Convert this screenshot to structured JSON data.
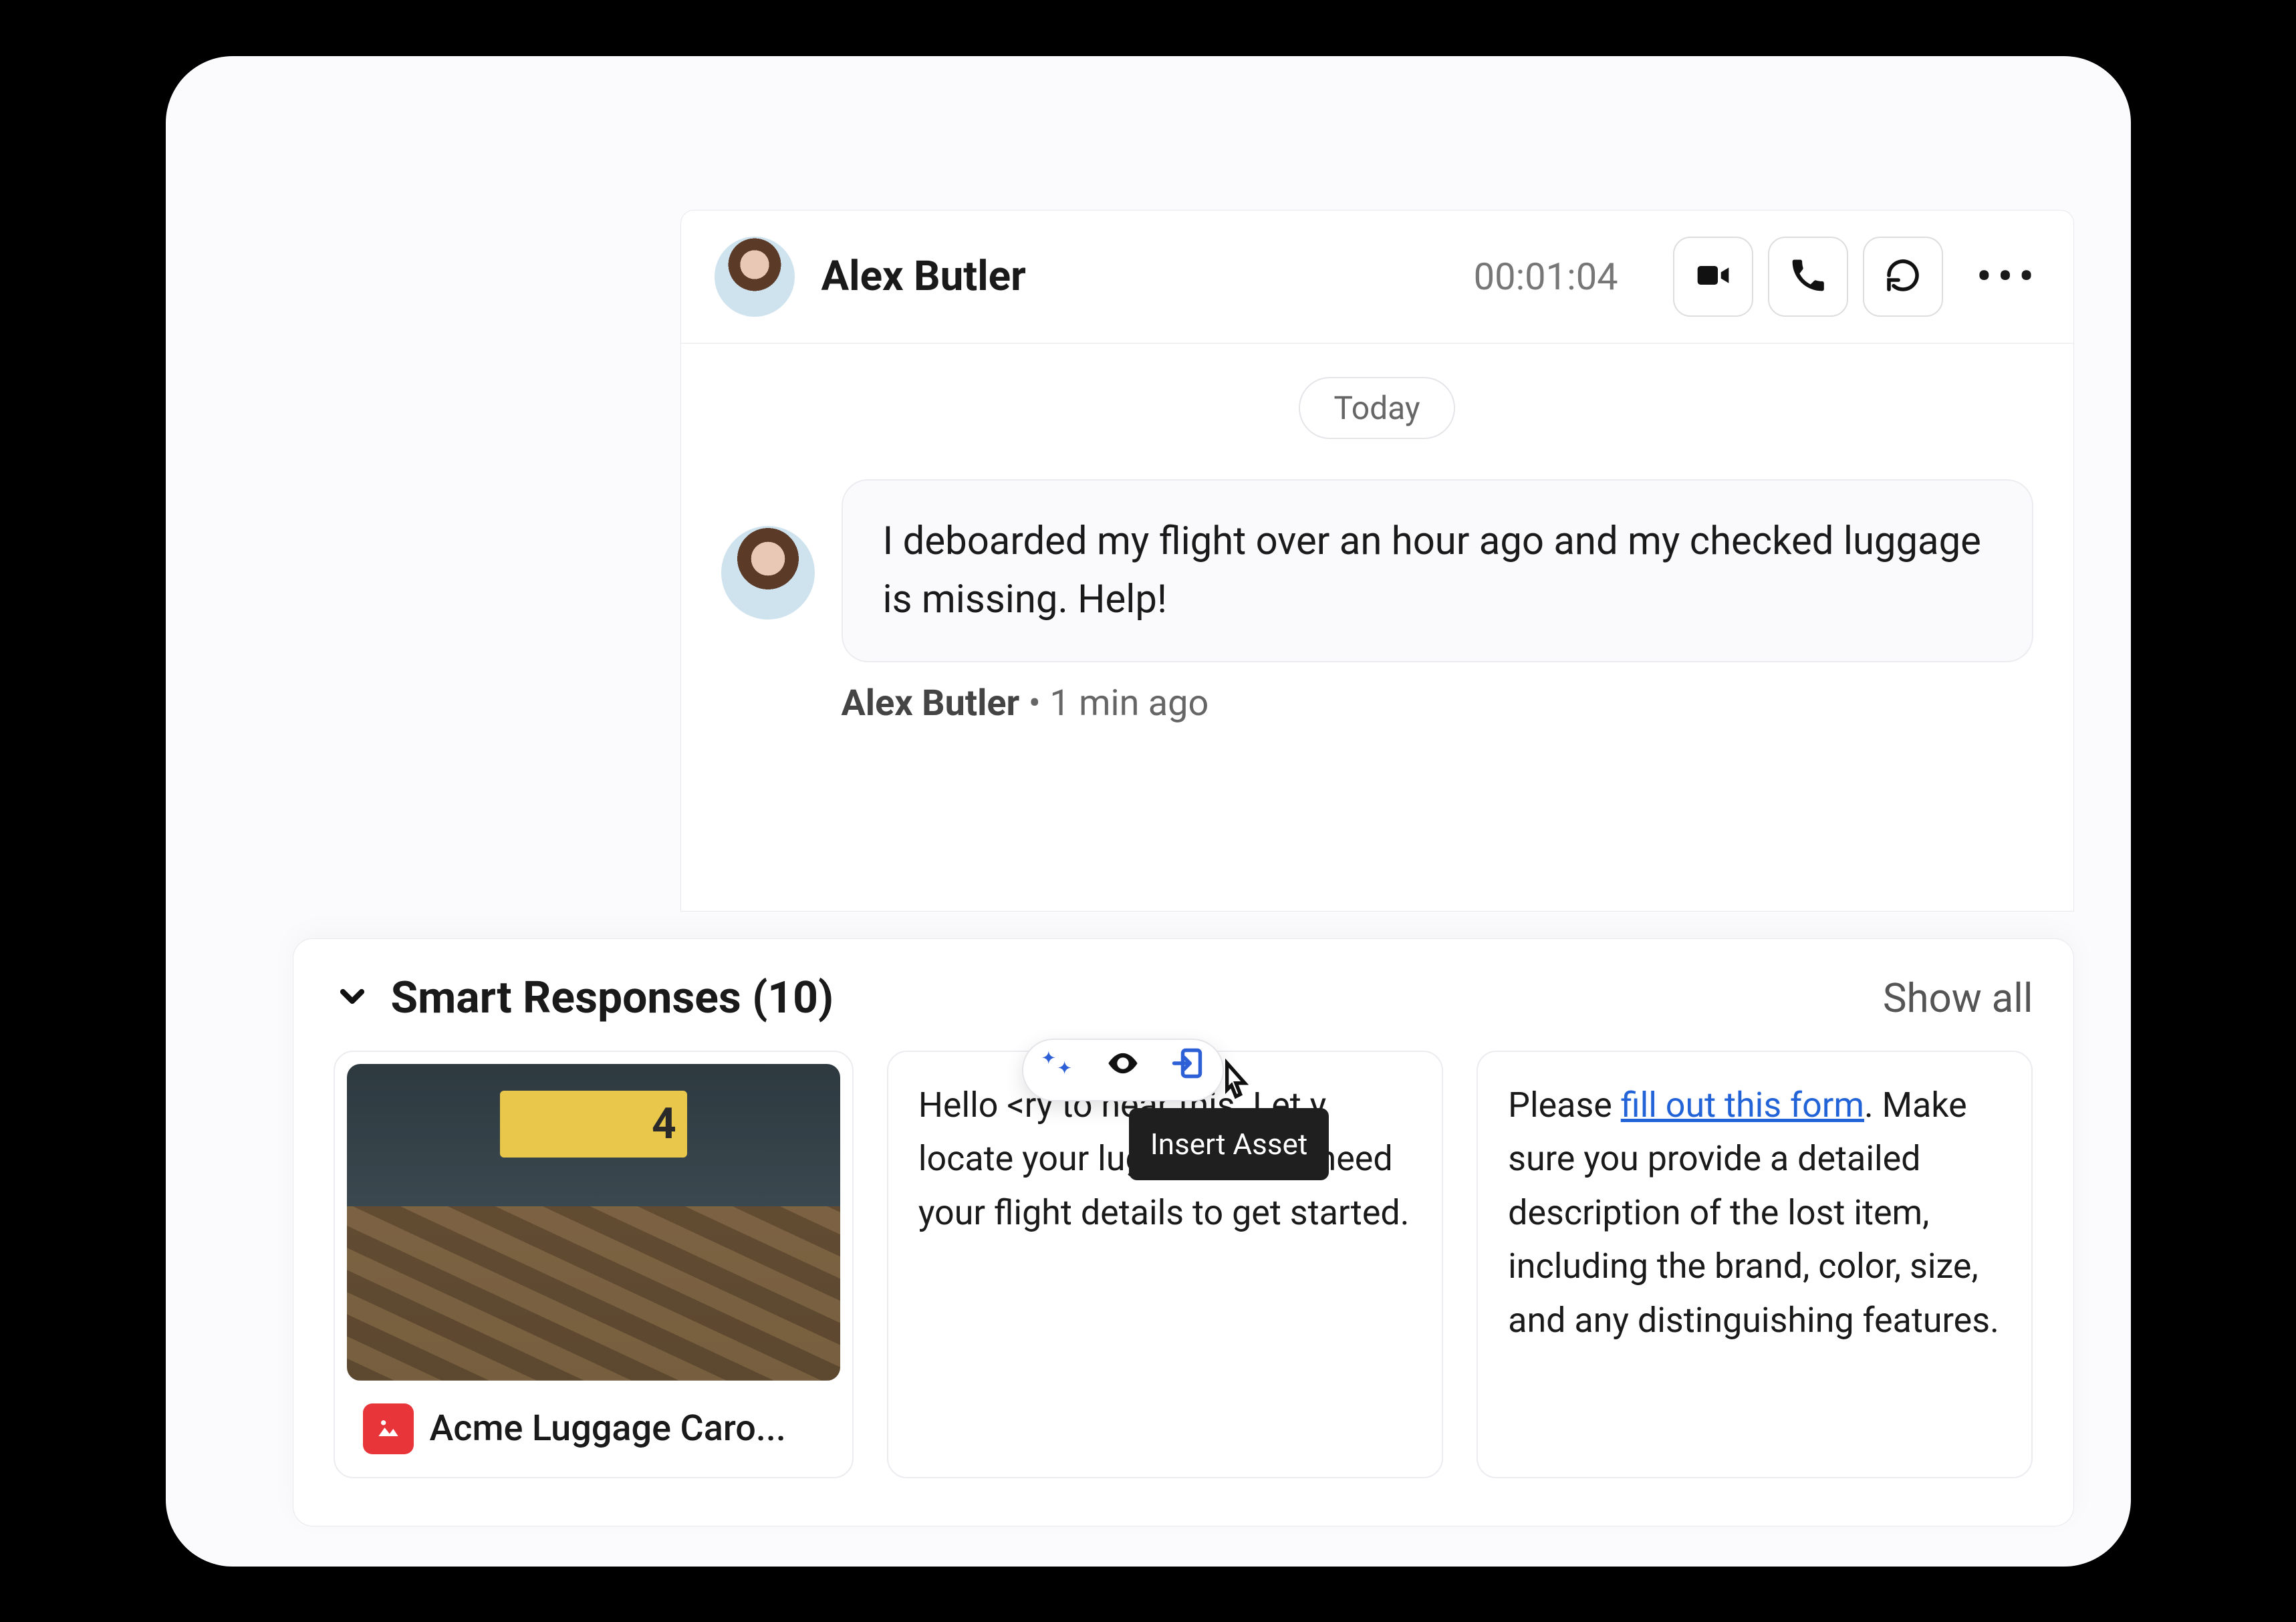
{
  "header": {
    "customer_name": "Alex Butler",
    "timer": "00:01:04"
  },
  "chat": {
    "date_label": "Today",
    "message": {
      "text": "I deboarded my flight over an hour ago and my checked luggage is missing. Help!",
      "author": "Alex Butler",
      "time_suffix": " • 1 min ago"
    }
  },
  "smart_responses": {
    "title_prefix": "Smart Responses (",
    "count": "10",
    "title_suffix": ")",
    "show_all": "Show all",
    "tooltip": "Insert Asset",
    "cards": {
      "image": {
        "sign_number": "4",
        "caption": "Acme Luggage Caro..."
      },
      "text1": {
        "pre": "Hello <",
        "post": "ry to hear this. Let           y locate your luggage.  I will need your flight details to get started."
      },
      "text2": {
        "pre": "Please ",
        "link": "fill out this form",
        "post": ". Make sure you provide a detailed description of the lost item, including the brand, color, size, and any distinguishing features."
      }
    }
  }
}
